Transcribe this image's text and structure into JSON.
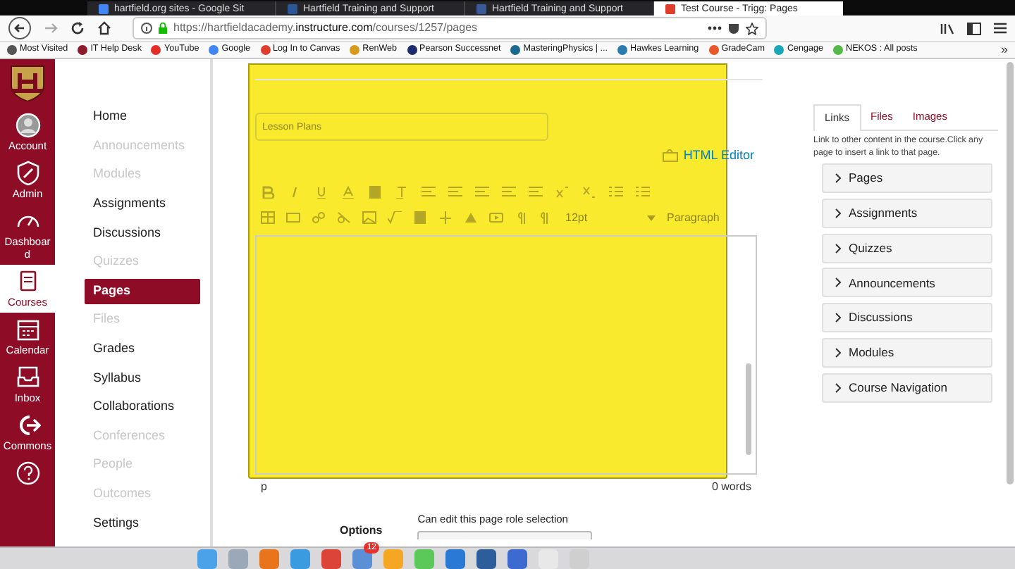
{
  "browser": {
    "tabs": [
      {
        "title": "hartfield.org sites - Google Sit",
        "selected": false
      },
      {
        "title": "Hartfield Training and Support",
        "selected": false
      },
      {
        "title": "Hartfield Training and Support",
        "selected": false
      },
      {
        "title": "Test Course - Trigg: Pages",
        "selected": true
      }
    ],
    "url_prefix": "https://hartfieldacademy.",
    "url_domain": "instructure.com",
    "url_path": "/courses/1257/pages",
    "bookmarks": [
      {
        "label": "Most Visited",
        "color": "#555555"
      },
      {
        "label": "IT Help Desk",
        "color": "#8b1a2b"
      },
      {
        "label": "YouTube",
        "color": "#e52d27"
      },
      {
        "label": "Google",
        "color": "#4285f4"
      },
      {
        "label": "Log In to Canvas",
        "color": "#e03e2d"
      },
      {
        "label": "RenWeb",
        "color": "#d79a1c"
      },
      {
        "label": "Pearson Successnet",
        "color": "#1d2a6b"
      },
      {
        "label": "MasteringPhysics | ...",
        "color": "#1a6a8e"
      },
      {
        "label": "Hawkes Learning",
        "color": "#2a7ab0"
      },
      {
        "label": "GradeCam",
        "color": "#e8562a"
      },
      {
        "label": "Cengage",
        "color": "#1aa6b7"
      },
      {
        "label": "NEKOS : All posts",
        "color": "#56b848"
      }
    ],
    "more": "»"
  },
  "global_nav": [
    {
      "kind": "account",
      "label": "Account",
      "selected": false
    },
    {
      "kind": "admin",
      "label": "Admin",
      "selected": false
    },
    {
      "kind": "dashboard",
      "label": "Dashboard",
      "selected": false
    },
    {
      "kind": "courses",
      "label": "Courses",
      "selected": true
    },
    {
      "kind": "calendar",
      "label": "Calendar",
      "selected": false
    },
    {
      "kind": "inbox",
      "label": "Inbox",
      "selected": false
    },
    {
      "kind": "commons",
      "label": "Commons",
      "selected": false
    },
    {
      "kind": "help",
      "selected": false
    }
  ],
  "course_nav": [
    {
      "label": "Home",
      "disabled": false,
      "selected": false
    },
    {
      "label": "Announcements",
      "disabled": true,
      "selected": false
    },
    {
      "label": "Modules",
      "disabled": true,
      "selected": false
    },
    {
      "label": "Assignments",
      "disabled": false,
      "selected": false
    },
    {
      "label": "Discussions",
      "disabled": false,
      "selected": false
    },
    {
      "label": "Quizzes",
      "disabled": true,
      "selected": false
    },
    {
      "label": "Pages",
      "disabled": false,
      "selected": true
    },
    {
      "label": "Files",
      "disabled": true,
      "selected": false
    },
    {
      "label": "Grades",
      "disabled": false,
      "selected": false
    },
    {
      "label": "Syllabus",
      "disabled": false,
      "selected": false
    },
    {
      "label": "Collaborations",
      "disabled": false,
      "selected": false
    },
    {
      "label": "Conferences",
      "disabled": true,
      "selected": false
    },
    {
      "label": "People",
      "disabled": true,
      "selected": false
    },
    {
      "label": "Outcomes",
      "disabled": true,
      "selected": false
    },
    {
      "label": "Settings",
      "disabled": false,
      "selected": false
    }
  ],
  "editor": {
    "title_value": "Lesson Plans",
    "html_editor_link": "HTML Editor",
    "font_size": "12pt",
    "block_format": "Paragraph",
    "path": "p",
    "word_count": "0 words"
  },
  "sidebar": {
    "tabs": [
      {
        "label": "Links",
        "selected": true
      },
      {
        "label": "Files",
        "selected": false
      },
      {
        "label": "Images",
        "selected": false
      }
    ],
    "hint": "Link to other content in the course.Click any page to insert a link to that page.",
    "sections": [
      {
        "label": "Pages",
        "expanded": false
      },
      {
        "label": "Assignments",
        "expanded": false
      },
      {
        "label": "Quizzes",
        "expanded": false
      },
      {
        "label": "Announcements",
        "expanded": false
      },
      {
        "label": "Discussions",
        "expanded": false
      },
      {
        "label": "Modules",
        "expanded": false
      },
      {
        "label": "Course Navigation",
        "expanded": false
      }
    ]
  },
  "options": {
    "label": "Options",
    "role_label": "Can edit this page role selection"
  },
  "dock": {
    "badge": "12"
  }
}
